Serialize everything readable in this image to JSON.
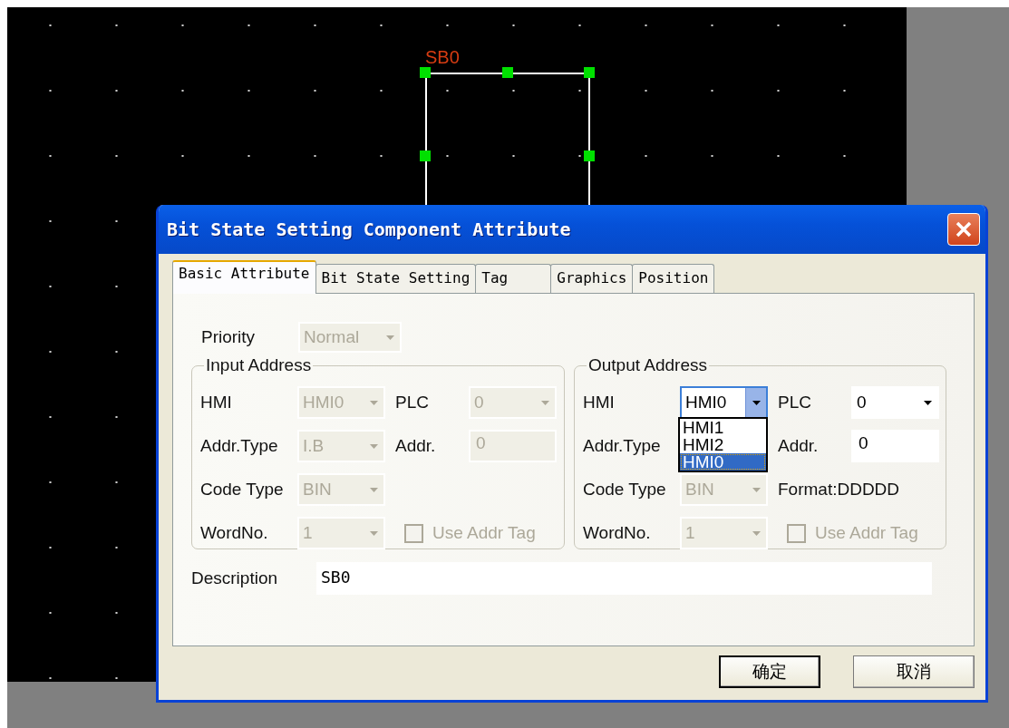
{
  "canvas": {
    "component": {
      "label": "SB0",
      "selected": true
    }
  },
  "dialog": {
    "title": "Bit State Setting Component Attribute",
    "tabs": [
      {
        "label": "Basic Attribute",
        "selected": true
      },
      {
        "label": "Bit State Setting",
        "selected": false
      },
      {
        "label": "Tag",
        "selected": false
      },
      {
        "label": "Graphics",
        "selected": false
      },
      {
        "label": "Position",
        "selected": false
      }
    ],
    "priority": {
      "label": "Priority",
      "value": "Normal",
      "disabled": true
    },
    "groups": [
      {
        "title": "Input Address",
        "rows": [
          [
            {
              "kind": "combo",
              "label": "HMI",
              "value": "HMI0",
              "disabled": true
            },
            {
              "kind": "combo",
              "label": "PLC",
              "value": "0",
              "disabled": true
            }
          ],
          [
            {
              "kind": "combo",
              "label": "Addr.Type",
              "value": "I.B",
              "disabled": true
            },
            {
              "kind": "text",
              "label": "Addr.",
              "value": "0",
              "disabled": true
            }
          ],
          [
            {
              "kind": "combo",
              "label": "Code Type",
              "value": "BIN",
              "disabled": true
            }
          ],
          [
            {
              "kind": "combo",
              "label": "WordNo.",
              "value": "1",
              "disabled": true
            },
            {
              "kind": "checkbox",
              "label": "Use Addr Tag",
              "checked": false,
              "disabled": true
            }
          ]
        ]
      },
      {
        "title": "Output Address",
        "rows": [
          [
            {
              "kind": "combo",
              "label": "HMI",
              "value": "HMI0",
              "disabled": false,
              "expanded": true,
              "options": [
                {
                  "label": "HMI1",
                  "selected": false
                },
                {
                  "label": "HMI2",
                  "selected": false
                },
                {
                  "label": "HMI0",
                  "selected": true
                }
              ]
            },
            {
              "kind": "combo",
              "label": "PLC",
              "value": "0",
              "disabled": false
            }
          ],
          [
            {
              "kind": "label",
              "label": "Addr.Type"
            },
            {
              "kind": "text",
              "label": "Addr.",
              "value": "0",
              "disabled": false
            }
          ],
          [
            {
              "kind": "combo",
              "label": "Code Type",
              "value": "BIN",
              "disabled": true
            },
            {
              "kind": "note",
              "label": "Format:DDDDD"
            }
          ],
          [
            {
              "kind": "combo",
              "label": "WordNo.",
              "value": "1",
              "disabled": true
            },
            {
              "kind": "checkbox",
              "label": "Use Addr Tag",
              "checked": false,
              "disabled": true
            }
          ]
        ]
      }
    ],
    "description": {
      "label": "Description",
      "value": "SB0"
    },
    "buttons": [
      {
        "label": "确定",
        "default": true
      },
      {
        "label": "取消",
        "default": false
      }
    ]
  }
}
